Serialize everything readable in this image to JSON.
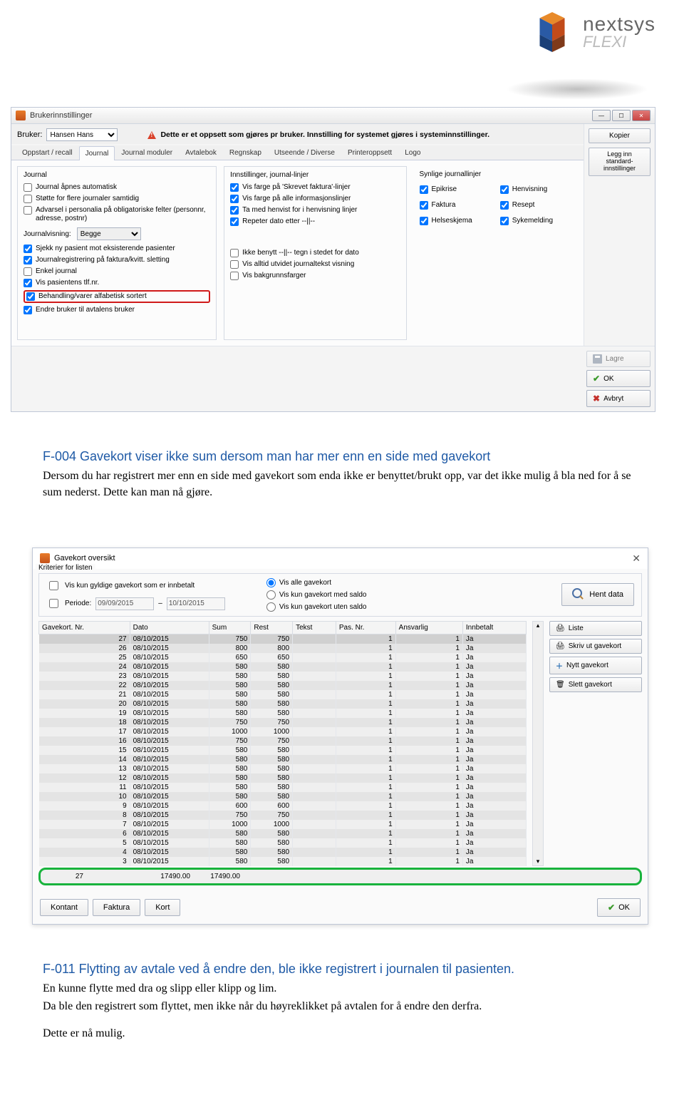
{
  "logo": {
    "brand": "nextsys",
    "sub": "FLEXI"
  },
  "win1": {
    "title": "Brukerinnstillinger",
    "user_label": "Bruker:",
    "user_value": "Hansen Hans",
    "warning": "Dette er et oppsett som gjøres pr bruker. Innstilling for systemet gjøres i systeminnstillinger.",
    "tabs": [
      "Oppstart / recall",
      "Journal",
      "Journal moduler",
      "Avtalebok",
      "Regnskap",
      "Utseende / Diverse",
      "Printeroppsett",
      "Logo"
    ],
    "active_tab": 1,
    "group_journal": {
      "title": "Journal",
      "items": [
        {
          "label": "Journal åpnes automatisk",
          "checked": false
        },
        {
          "label": "Støtte for flere journaler samtidig",
          "checked": false
        },
        {
          "label": "Advarsel i personalia på obligatoriske felter (personnr, adresse, postnr)",
          "checked": false
        }
      ],
      "visning_label": "Journalvisning:",
      "visning_value": "Begge",
      "items2": [
        {
          "label": "Sjekk ny pasient mot eksisterende pasienter",
          "checked": true
        },
        {
          "label": "Journalregistrering på faktura/kvitt. sletting",
          "checked": true
        },
        {
          "label": "Enkel journal",
          "checked": false
        },
        {
          "label": "Vis pasientens tlf.nr.",
          "checked": true
        },
        {
          "label": "Behandling/varer alfabetisk sortert",
          "checked": true,
          "highlight": true
        },
        {
          "label": "Endre bruker til avtalens bruker",
          "checked": true
        }
      ]
    },
    "group_linjer": {
      "title": "Innstillinger, journal-linjer",
      "items": [
        {
          "label": "Vis farge på 'Skrevet faktura'-linjer",
          "checked": true
        },
        {
          "label": "Vis farge på alle informasjonslinjer",
          "checked": true
        },
        {
          "label": "Ta med henvist for i henvisning linjer",
          "checked": true
        },
        {
          "label": "Repeter dato etter --||--",
          "checked": true
        }
      ],
      "items2": [
        {
          "label": "Ikke benytt --||-- tegn i stedet for dato",
          "checked": false
        },
        {
          "label": "Vis alltid utvidet journaltekst visning",
          "checked": false
        },
        {
          "label": "Vis bakgrunnsfarger",
          "checked": false
        }
      ]
    },
    "group_synlige": {
      "title": "Synlige journallinjer",
      "items": [
        {
          "label": "Epikrise",
          "checked": true
        },
        {
          "label": "Henvisning",
          "checked": true
        },
        {
          "label": "Faktura",
          "checked": true
        },
        {
          "label": "Resept",
          "checked": true
        },
        {
          "label": "Helseskjema",
          "checked": true
        },
        {
          "label": "Sykemelding",
          "checked": true
        }
      ]
    },
    "side_buttons": {
      "kopier": "Kopier",
      "std": "Legg inn standard-innstillinger"
    },
    "footer": {
      "lagre": "Lagre",
      "ok": "OK",
      "avbryt": "Avbryt"
    }
  },
  "article1": {
    "heading": "F-004 Gavekort viser ikke sum dersom man har mer enn en side med gavekort",
    "body": "Dersom du har registrert mer enn en side med gavekort som enda ikke er benyttet/brukt opp, var det ikke mulig å bla ned for å se sum nederst. Dette kan man nå gjøre."
  },
  "win2": {
    "title": "Gavekort oversikt",
    "criteria": {
      "title": "Kriterier for listen",
      "gyldige": "Vis kun gyldige gavekort som er innbetalt",
      "periode_label": "Periode:",
      "date_from": "09/09/2015",
      "date_to": "10/10/2015",
      "radio": [
        {
          "label": "Vis alle gavekort",
          "checked": true
        },
        {
          "label": "Vis kun gavekort med saldo",
          "checked": false
        },
        {
          "label": "Vis kun gavekort uten saldo",
          "checked": false
        }
      ],
      "hent": "Hent data"
    },
    "columns": [
      "Gavekort. Nr.",
      "Dato",
      "Sum",
      "Rest",
      "Tekst",
      "Pas. Nr.",
      "Ansvarlig",
      "Innbetalt"
    ],
    "rows": [
      {
        "nr": 27,
        "dato": "08/10/2015",
        "sum": 750,
        "rest": 750,
        "pas": 1,
        "ans": 1,
        "inn": "Ja"
      },
      {
        "nr": 26,
        "dato": "08/10/2015",
        "sum": 800,
        "rest": 800,
        "pas": 1,
        "ans": 1,
        "inn": "Ja"
      },
      {
        "nr": 25,
        "dato": "08/10/2015",
        "sum": 650,
        "rest": 650,
        "pas": 1,
        "ans": 1,
        "inn": "Ja"
      },
      {
        "nr": 24,
        "dato": "08/10/2015",
        "sum": 580,
        "rest": 580,
        "pas": 1,
        "ans": 1,
        "inn": "Ja"
      },
      {
        "nr": 23,
        "dato": "08/10/2015",
        "sum": 580,
        "rest": 580,
        "pas": 1,
        "ans": 1,
        "inn": "Ja"
      },
      {
        "nr": 22,
        "dato": "08/10/2015",
        "sum": 580,
        "rest": 580,
        "pas": 1,
        "ans": 1,
        "inn": "Ja"
      },
      {
        "nr": 21,
        "dato": "08/10/2015",
        "sum": 580,
        "rest": 580,
        "pas": 1,
        "ans": 1,
        "inn": "Ja"
      },
      {
        "nr": 20,
        "dato": "08/10/2015",
        "sum": 580,
        "rest": 580,
        "pas": 1,
        "ans": 1,
        "inn": "Ja"
      },
      {
        "nr": 19,
        "dato": "08/10/2015",
        "sum": 580,
        "rest": 580,
        "pas": 1,
        "ans": 1,
        "inn": "Ja"
      },
      {
        "nr": 18,
        "dato": "08/10/2015",
        "sum": 750,
        "rest": 750,
        "pas": 1,
        "ans": 1,
        "inn": "Ja"
      },
      {
        "nr": 17,
        "dato": "08/10/2015",
        "sum": 1000,
        "rest": 1000,
        "pas": 1,
        "ans": 1,
        "inn": "Ja"
      },
      {
        "nr": 16,
        "dato": "08/10/2015",
        "sum": 750,
        "rest": 750,
        "pas": 1,
        "ans": 1,
        "inn": "Ja"
      },
      {
        "nr": 15,
        "dato": "08/10/2015",
        "sum": 580,
        "rest": 580,
        "pas": 1,
        "ans": 1,
        "inn": "Ja"
      },
      {
        "nr": 14,
        "dato": "08/10/2015",
        "sum": 580,
        "rest": 580,
        "pas": 1,
        "ans": 1,
        "inn": "Ja"
      },
      {
        "nr": 13,
        "dato": "08/10/2015",
        "sum": 580,
        "rest": 580,
        "pas": 1,
        "ans": 1,
        "inn": "Ja"
      },
      {
        "nr": 12,
        "dato": "08/10/2015",
        "sum": 580,
        "rest": 580,
        "pas": 1,
        "ans": 1,
        "inn": "Ja"
      },
      {
        "nr": 11,
        "dato": "08/10/2015",
        "sum": 580,
        "rest": 580,
        "pas": 1,
        "ans": 1,
        "inn": "Ja"
      },
      {
        "nr": 10,
        "dato": "08/10/2015",
        "sum": 580,
        "rest": 580,
        "pas": 1,
        "ans": 1,
        "inn": "Ja"
      },
      {
        "nr": 9,
        "dato": "08/10/2015",
        "sum": 600,
        "rest": 600,
        "pas": 1,
        "ans": 1,
        "inn": "Ja"
      },
      {
        "nr": 8,
        "dato": "08/10/2015",
        "sum": 750,
        "rest": 750,
        "pas": 1,
        "ans": 1,
        "inn": "Ja"
      },
      {
        "nr": 7,
        "dato": "08/10/2015",
        "sum": 1000,
        "rest": 1000,
        "pas": 1,
        "ans": 1,
        "inn": "Ja"
      },
      {
        "nr": 6,
        "dato": "08/10/2015",
        "sum": 580,
        "rest": 580,
        "pas": 1,
        "ans": 1,
        "inn": "Ja"
      },
      {
        "nr": 5,
        "dato": "08/10/2015",
        "sum": 580,
        "rest": 580,
        "pas": 1,
        "ans": 1,
        "inn": "Ja"
      },
      {
        "nr": 4,
        "dato": "08/10/2015",
        "sum": 580,
        "rest": 580,
        "pas": 1,
        "ans": 1,
        "inn": "Ja"
      },
      {
        "nr": 3,
        "dato": "08/10/2015",
        "sum": 580,
        "rest": 580,
        "pas": 1,
        "ans": 1,
        "inn": "Ja"
      }
    ],
    "totals": {
      "count": 27,
      "sum": "17490.00",
      "rest": "17490.00"
    },
    "actions": {
      "liste": "Liste",
      "skriv": "Skriv ut gavekort",
      "nytt": "Nytt gavekort",
      "slett": "Slett gavekort"
    },
    "bottom": {
      "kontant": "Kontant",
      "faktura": "Faktura",
      "kort": "Kort",
      "ok": "OK"
    }
  },
  "article2": {
    "heading": "F-011 Flytting av avtale ved å endre den, ble ikke registrert i journalen til pasienten.",
    "body1": "En kunne flytte med dra og slipp eller klipp og lim.",
    "body2": "Da ble den registrert som flyttet, men ikke når du høyreklikket på avtalen for å endre den derfra.",
    "body3": "Dette er nå mulig."
  }
}
